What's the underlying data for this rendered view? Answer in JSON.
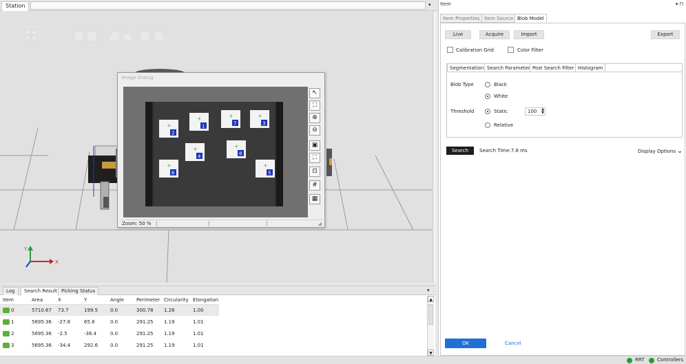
{
  "station": {
    "tab_label": "Station",
    "menu_icon": "▾"
  },
  "image_dialog": {
    "title": "Image Dialog",
    "zoom_label": "Zoom: 50 %",
    "tool_icons": [
      "select-arrow-icon",
      "fit-region-icon",
      "zoom-in-icon",
      "zoom-out-icon",
      "image-icon",
      "fullscreen-icon",
      "crosshair-box-icon",
      "grid-icon",
      "fine-grid-icon"
    ],
    "blobs": [
      {
        "label": "2"
      },
      {
        "label": "1"
      },
      {
        "label": "7"
      },
      {
        "label": "3"
      },
      {
        "label": "4"
      },
      {
        "label": "8"
      },
      {
        "label": "6"
      },
      {
        "label": "5"
      }
    ]
  },
  "bottom_panel": {
    "tabs": [
      "Log",
      "Search Result",
      "Picking Status"
    ],
    "active_tab": "Search Result",
    "menu_icon": "▾",
    "columns": [
      "Item",
      "Area",
      "X",
      "Y",
      "Angle",
      "Perimeter",
      "Circularity",
      "Elongation"
    ],
    "rows": [
      [
        "0",
        "5710.67",
        "73.7",
        "199.5",
        "0.0",
        "300.78",
        "1.26",
        "1.00"
      ],
      [
        "1",
        "5695.36",
        "-27.8",
        "65.8",
        "0.0",
        "291.25",
        "1.19",
        "1.01"
      ],
      [
        "2",
        "5695.36",
        "-2.5",
        "-36.4",
        "0.0",
        "291.25",
        "1.19",
        "1.01"
      ],
      [
        "3",
        "5695.36",
        "-34.4",
        "292.6",
        "0.0",
        "291.25",
        "1.19",
        "1.01"
      ]
    ]
  },
  "item_panel": {
    "title": "Item",
    "menu_icon": "▾ ⊓",
    "tabs": [
      "Item Properties",
      "Item Source",
      "Blob Model"
    ],
    "active_tab": "Blob Model",
    "buttons": {
      "live": "Live",
      "acquire": "Acquire",
      "import": "Import",
      "export": "Export"
    },
    "calibration_grid": "Calibration Grid",
    "color_filter": "Color Filter",
    "sub_tabs": [
      "Segmentation",
      "Search Parameter",
      "Post Search Filter",
      "Histogram"
    ],
    "active_sub_tab": "Segmentation",
    "blob_type_label": "Blob Type",
    "blob_type_options": [
      "Black",
      "White"
    ],
    "blob_type_selected": "White",
    "threshold_label": "Threshold",
    "threshold_options": [
      "Static",
      "Relative"
    ],
    "threshold_selected": "Static",
    "threshold_value": "100",
    "search_button": "Search",
    "search_time": "Search Time:7.8 ms",
    "display_options": "Display Options",
    "ok": "OK",
    "cancel": "Cancel"
  },
  "status_bar": {
    "rrt": "RRT",
    "controllers": "Controllers",
    "led_color": "#2d9a3a"
  },
  "viewport_axes": {
    "y": "Y",
    "x": "X"
  }
}
